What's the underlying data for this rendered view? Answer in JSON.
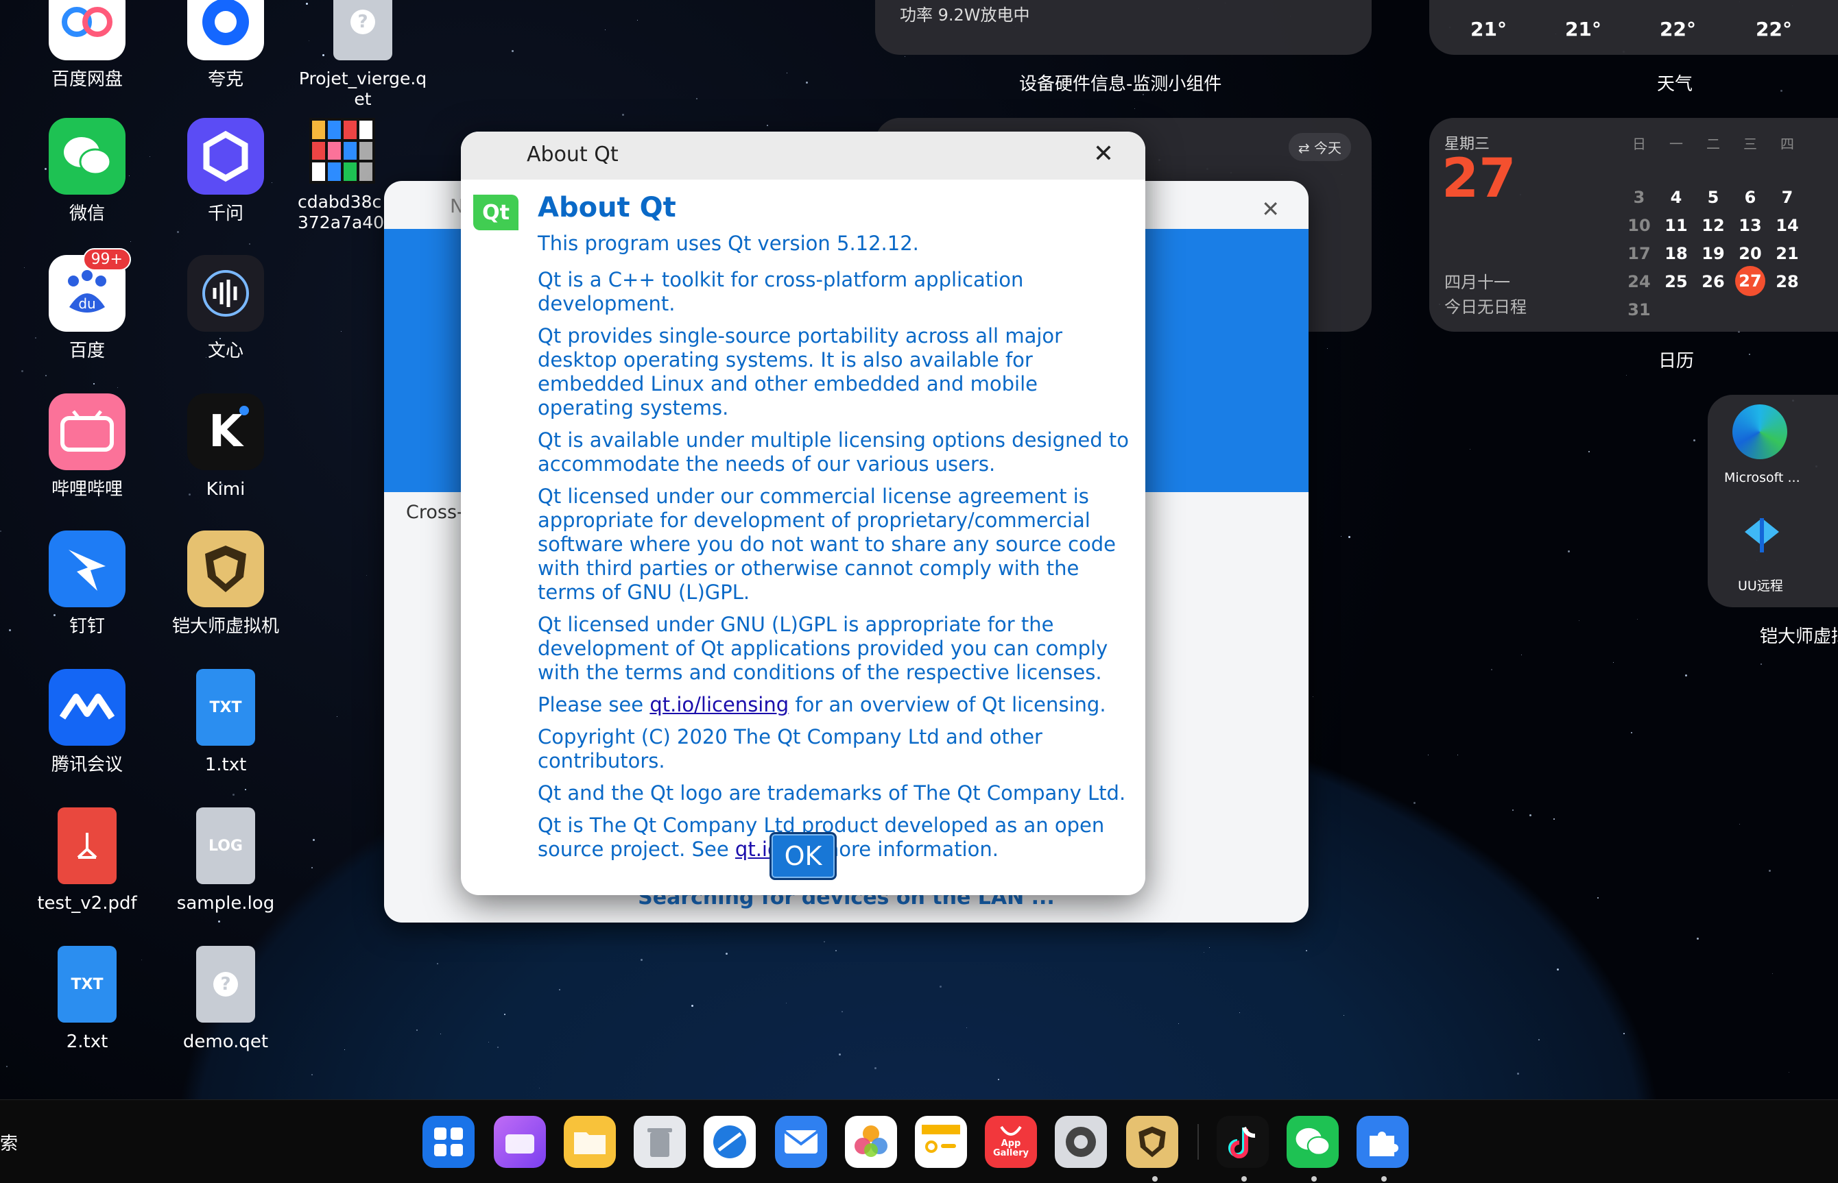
{
  "desktop_icons": [
    {
      "label": "百度网盘",
      "icon": "baidu-netdisk-icon"
    },
    {
      "label": "夸克",
      "icon": "quark-icon"
    },
    {
      "label": "Projet_vierge.qet",
      "icon": "unknown-file-icon"
    },
    {
      "label": "微信",
      "icon": "wechat-icon"
    },
    {
      "label": "千问",
      "icon": "qianwen-icon"
    },
    {
      "label": "cdabd38c372a7a40",
      "icon": "image-file-icon"
    },
    {
      "label": "百度",
      "icon": "baidu-icon",
      "badge": "99+"
    },
    {
      "label": "文心",
      "icon": "wenxin-icon"
    },
    {
      "label": "哔哩哔哩",
      "icon": "bilibili-icon"
    },
    {
      "label": "Kimi",
      "icon": "kimi-icon"
    },
    {
      "label": "钉钉",
      "icon": "dingtalk-icon"
    },
    {
      "label": "铠大师虚拟机",
      "icon": "kaidashi-vm-icon"
    },
    {
      "label": "腾讯会议",
      "icon": "tencent-meeting-icon"
    },
    {
      "label": "1.txt",
      "icon": "txt-file-icon",
      "filetype": "TXT"
    },
    {
      "label": "test_v2.pdf",
      "icon": "pdf-file-icon"
    },
    {
      "label": "sample.log",
      "icon": "log-file-icon",
      "filetype": "LOG"
    },
    {
      "label": "2.txt",
      "icon": "txt-file-icon",
      "filetype": "TXT"
    },
    {
      "label": "demo.qet",
      "icon": "unknown-file-icon"
    }
  ],
  "widgets": {
    "hardware": {
      "power_text": "功率 9.2W放电中",
      "label": "设备硬件信息-监测小组件"
    },
    "weather": {
      "temps": [
        "21°",
        "21°",
        "22°",
        "22°"
      ],
      "label": "天气"
    },
    "calendar": {
      "weekday": "星期三",
      "day": "27",
      "lunar": "四月十一",
      "no_events": "今日无日程",
      "header": [
        "日",
        "一",
        "二",
        "三",
        "四"
      ],
      "rows": [
        [
          "3",
          "4",
          "5",
          "6",
          "7"
        ],
        [
          "10",
          "11",
          "12",
          "13",
          "14"
        ],
        [
          "17",
          "18",
          "19",
          "20",
          "21"
        ],
        [
          "24",
          "25",
          "26",
          "27",
          "28"
        ],
        [
          "31",
          "",
          "",
          "",
          ""
        ]
      ],
      "today": "27",
      "label": "日历"
    },
    "today_button": "今天",
    "app_widget": {
      "items": [
        "Microsoft ...",
        "UU远程"
      ],
      "label": "铠大师虚拟"
    }
  },
  "back_window": {
    "left_text": "Cross-",
    "top_text": "N",
    "status": "Searching for devices on the LAN ..."
  },
  "about_dialog": {
    "title": "About Qt",
    "logo_text": "Qt",
    "heading": "About Qt",
    "paragraphs": [
      "This program uses Qt version 5.12.12.",
      "Qt is a C++ toolkit for cross-platform application development.",
      "Qt provides single-source portability across all major desktop operating systems. It is also available for embedded Linux and other embedded and mobile operating systems.",
      "Qt is available under multiple licensing options designed to accommodate the needs of our various users.",
      "Qt licensed under our commercial license agreement is appropriate for development of proprietary/commercial software where you do not want to share any source code with third parties or otherwise cannot comply with the terms of GNU (L)GPL.",
      "Qt licensed under GNU (L)GPL is appropriate for the development of Qt applications provided you can comply with the terms and conditions of the respective licenses."
    ],
    "licensing_pre": "Please see ",
    "licensing_link": "qt.io/licensing",
    "licensing_post": " for an overview of Qt licensing.",
    "copyright": "Copyright (C) 2020 The Qt Company Ltd and other contributors.",
    "trademark": "Qt and the Qt logo are trademarks of The Qt Company Ltd.",
    "project_pre": "Qt is The Qt Company Ltd product developed as an open source project. See ",
    "project_link": "qt.io",
    "project_post": " for more information.",
    "ok_label": "OK"
  },
  "taskbar": {
    "search_fragment": "索",
    "apps": [
      "launcher-icon",
      "multitask-icon",
      "files-icon",
      "trash-icon",
      "browser-icon",
      "mail-icon",
      "photos-icon",
      "notes-icon",
      "app-gallery-icon",
      "settings-icon",
      "kaidashi-icon",
      "tiktok-icon",
      "wechat-icon",
      "extensions-icon"
    ],
    "app_gallery_label": "App Gallery"
  }
}
